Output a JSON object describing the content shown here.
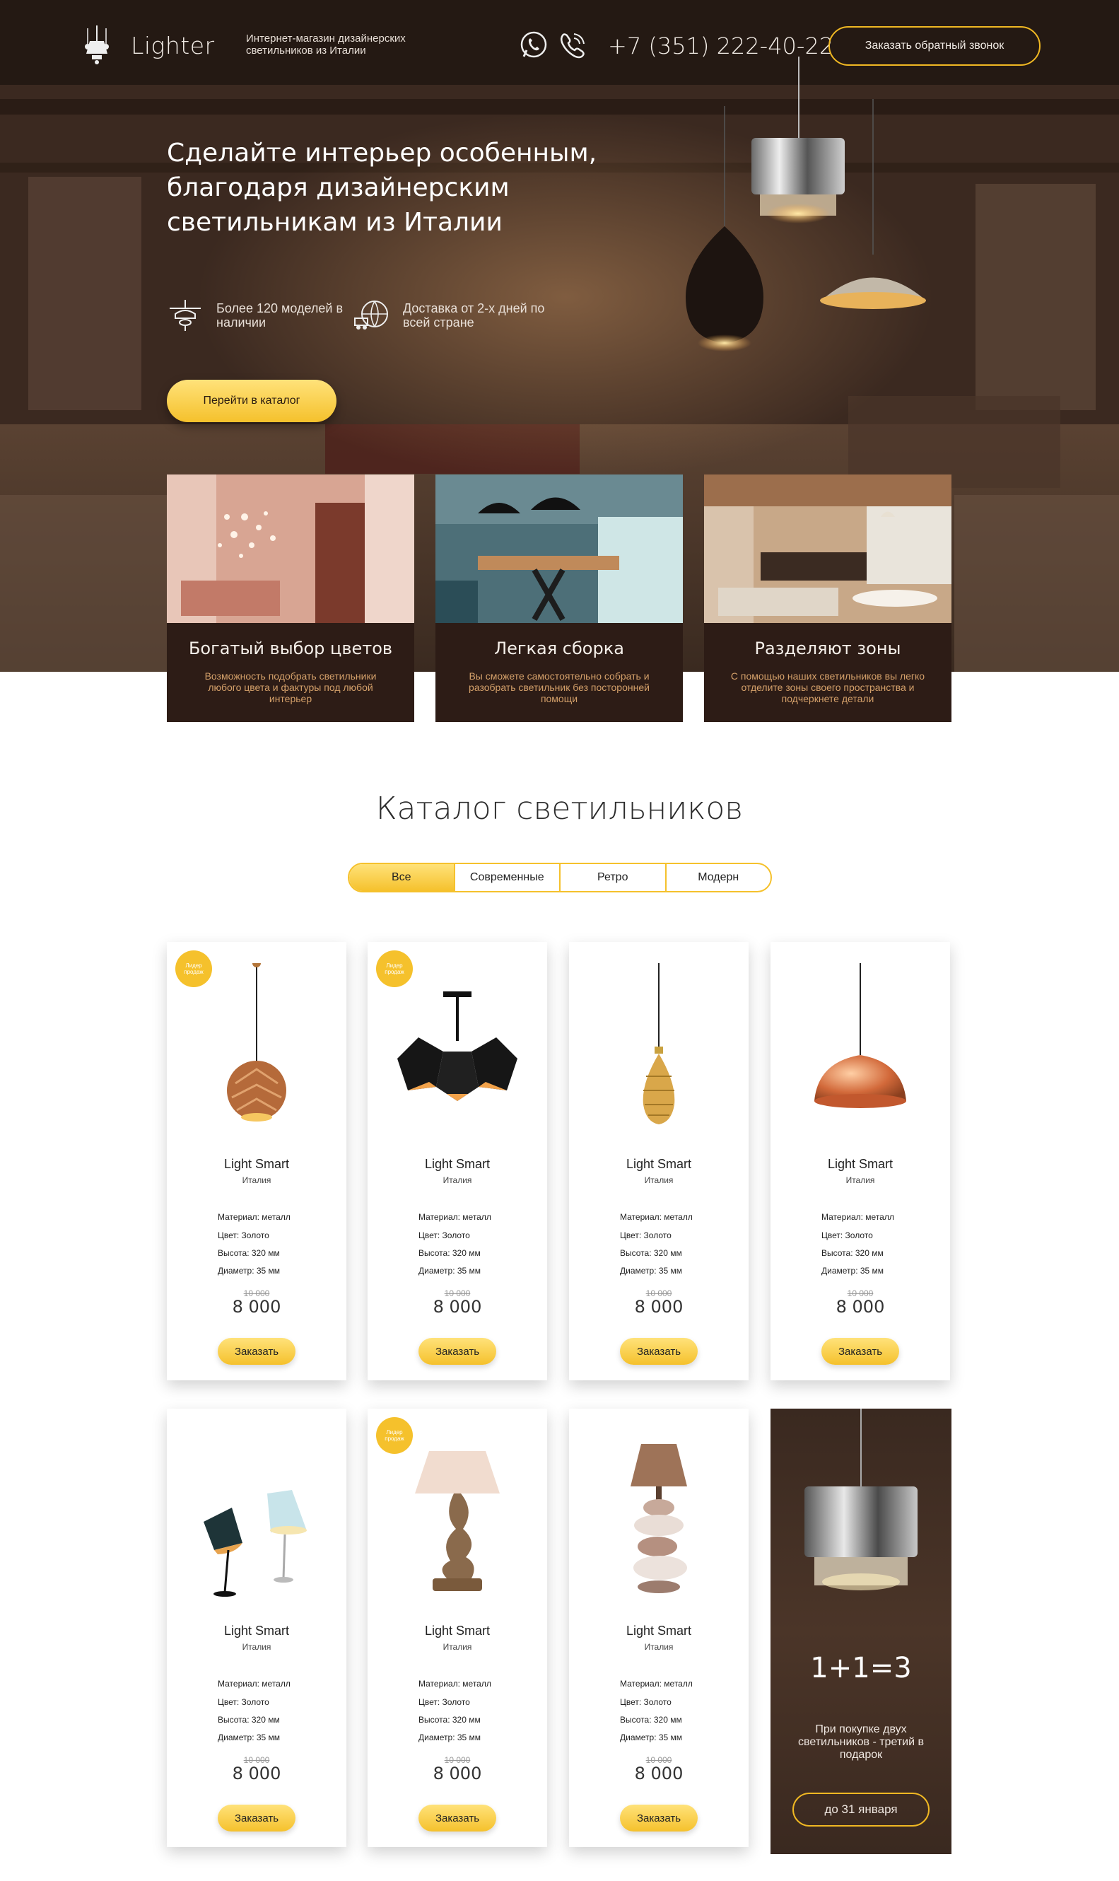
{
  "header": {
    "logo_text": "Lighter",
    "tagline": "Интернет-магазин дизайнерских светильников из Италии",
    "phone": "+7 (351) 222-40-22",
    "callback_label": "Заказать обратный звонок"
  },
  "hero": {
    "title": "Сделайте интерьер особенным, благодаря дизайнерским светильникам из Италии",
    "features": [
      {
        "icon": "lamp-icon",
        "text": "Более 120 моделей в наличии"
      },
      {
        "icon": "globe-truck-icon",
        "text": "Доставка от 2-х дней по всей стране"
      }
    ],
    "catalog_button": "Перейти в каталог"
  },
  "benefits": [
    {
      "title": "Богатый выбор цветов",
      "desc": "Возможность подобрать светильники любого цвета и фактуры под любой интерьер"
    },
    {
      "title": "Легкая сборка",
      "desc": "Вы сможете самостоятельно собрать и разобрать светильник без посторонней помощи"
    },
    {
      "title": "Разделяют зоны",
      "desc": "С помощью наших светильников вы легко отделите зоны своего пространства и подчеркнете детали"
    }
  ],
  "catalog": {
    "title": "Каталог светильников",
    "filters": [
      "Все",
      "Современные",
      "Ретро",
      "Модерн"
    ],
    "badge_text": "Лидер продаж",
    "products": [
      {
        "name": "Light Smart",
        "country": "Италия",
        "material": "Материал: металл",
        "color": "Цвет: Золото",
        "height": "Высота: 320 мм",
        "diameter": "Диаметр: 35 мм",
        "old_price": "10 000",
        "price": "8 000",
        "order": "Заказать"
      },
      {
        "name": "Light Smart",
        "country": "Италия",
        "material": "Материал: металл",
        "color": "Цвет: Золото",
        "height": "Высота: 320 мм",
        "diameter": "Диаметр: 35 мм",
        "old_price": "10 000",
        "price": "8 000",
        "order": "Заказать"
      },
      {
        "name": "Light Smart",
        "country": "Италия",
        "material": "Материал: металл",
        "color": "Цвет: Золото",
        "height": "Высота: 320 мм",
        "diameter": "Диаметр: 35 мм",
        "old_price": "10 000",
        "price": "8 000",
        "order": "Заказать"
      },
      {
        "name": "Light Smart",
        "country": "Италия",
        "material": "Материал: металл",
        "color": "Цвет: Золото",
        "height": "Высота: 320 мм",
        "diameter": "Диаметр: 35 мм",
        "old_price": "10 000",
        "price": "8 000",
        "order": "Заказать"
      },
      {
        "name": "Light Smart",
        "country": "Италия",
        "material": "Материал: металл",
        "color": "Цвет: Золото",
        "height": "Высота: 320 мм",
        "diameter": "Диаметр: 35 мм",
        "old_price": "10 000",
        "price": "8 000",
        "order": "Заказать"
      },
      {
        "name": "Light Smart",
        "country": "Италия",
        "material": "Материал: металл",
        "color": "Цвет: Золото",
        "height": "Высота: 320 мм",
        "diameter": "Диаметр: 35 мм",
        "old_price": "10 000",
        "price": "8 000",
        "order": "Заказать"
      },
      {
        "name": "Light Smart",
        "country": "Италия",
        "material": "Материал: металл",
        "color": "Цвет: Золото",
        "height": "Высота: 320 мм",
        "diameter": "Диаметр: 35 мм",
        "old_price": "10 000",
        "price": "8 000",
        "order": "Заказать"
      }
    ],
    "promo": {
      "title": "1+1=3",
      "text": "При покупке двух светильников - третий в подарок",
      "button": "до 31 января"
    }
  },
  "colors": {
    "accent": "#f5c12c",
    "dark_brown": "#2d1c16",
    "benefit_text": "#d4a06a"
  }
}
